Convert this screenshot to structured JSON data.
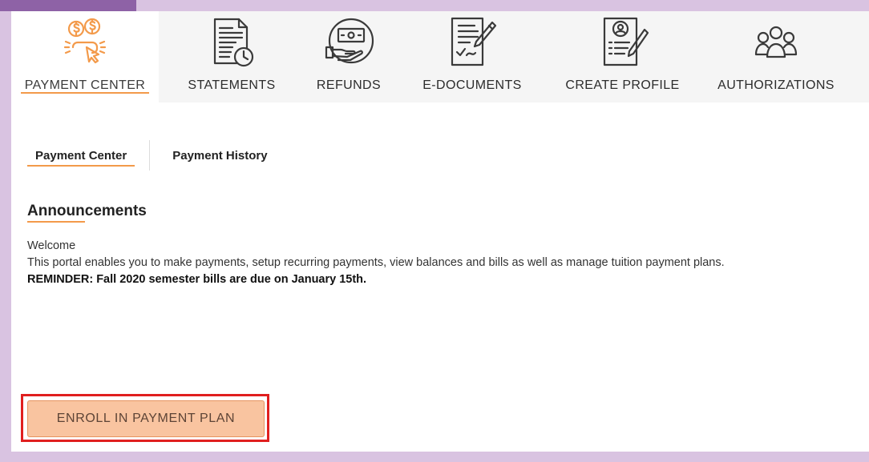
{
  "nav": {
    "tabs": [
      {
        "label": "PAYMENT CENTER",
        "icon": "payment-hand-icon"
      },
      {
        "label": "STATEMENTS",
        "icon": "statement-clock-icon"
      },
      {
        "label": "REFUNDS",
        "icon": "refund-hand-icon"
      },
      {
        "label": "E-DOCUMENTS",
        "icon": "signed-document-icon"
      },
      {
        "label": "CREATE PROFILE",
        "icon": "profile-document-icon"
      },
      {
        "label": "AUTHORIZATIONS",
        "icon": "group-users-icon"
      }
    ],
    "active_index": 0
  },
  "subtabs": [
    {
      "label": "Payment Center"
    },
    {
      "label": "Payment History"
    }
  ],
  "announcements": {
    "title": "Announcements",
    "line1": "Welcome",
    "line2": "This portal enables you to make payments, setup recurring payments, view balances and bills as well as manage tuition payment plans.",
    "reminder": "REMINDER: Fall 2020 semester bills are due on January 15th."
  },
  "enroll_button": {
    "label": "ENROLL IN PAYMENT PLAN"
  },
  "colors": {
    "accent_orange": "#f39a4a",
    "button_fill": "#f9c4a0",
    "highlight_red": "#e01f1f",
    "page_purple": "#d9c3e1"
  }
}
